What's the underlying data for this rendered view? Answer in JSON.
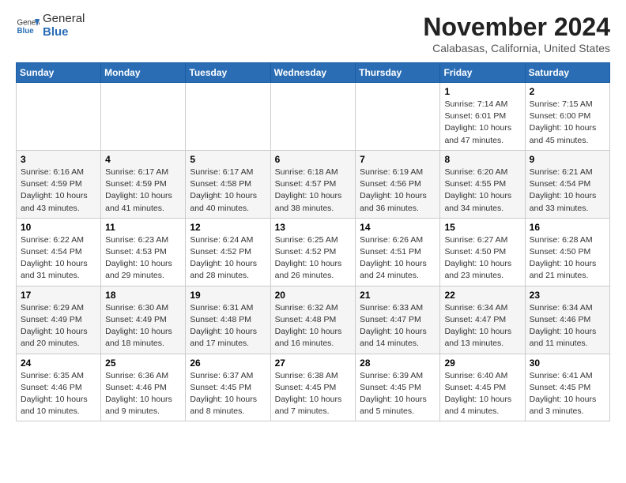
{
  "header": {
    "logo_general": "General",
    "logo_blue": "Blue",
    "month": "November 2024",
    "location": "Calabasas, California, United States"
  },
  "weekdays": [
    "Sunday",
    "Monday",
    "Tuesday",
    "Wednesday",
    "Thursday",
    "Friday",
    "Saturday"
  ],
  "weeks": [
    [
      {
        "day": "",
        "info": ""
      },
      {
        "day": "",
        "info": ""
      },
      {
        "day": "",
        "info": ""
      },
      {
        "day": "",
        "info": ""
      },
      {
        "day": "",
        "info": ""
      },
      {
        "day": "1",
        "info": "Sunrise: 7:14 AM\nSunset: 6:01 PM\nDaylight: 10 hours and 47 minutes."
      },
      {
        "day": "2",
        "info": "Sunrise: 7:15 AM\nSunset: 6:00 PM\nDaylight: 10 hours and 45 minutes."
      }
    ],
    [
      {
        "day": "3",
        "info": "Sunrise: 6:16 AM\nSunset: 4:59 PM\nDaylight: 10 hours and 43 minutes."
      },
      {
        "day": "4",
        "info": "Sunrise: 6:17 AM\nSunset: 4:59 PM\nDaylight: 10 hours and 41 minutes."
      },
      {
        "day": "5",
        "info": "Sunrise: 6:17 AM\nSunset: 4:58 PM\nDaylight: 10 hours and 40 minutes."
      },
      {
        "day": "6",
        "info": "Sunrise: 6:18 AM\nSunset: 4:57 PM\nDaylight: 10 hours and 38 minutes."
      },
      {
        "day": "7",
        "info": "Sunrise: 6:19 AM\nSunset: 4:56 PM\nDaylight: 10 hours and 36 minutes."
      },
      {
        "day": "8",
        "info": "Sunrise: 6:20 AM\nSunset: 4:55 PM\nDaylight: 10 hours and 34 minutes."
      },
      {
        "day": "9",
        "info": "Sunrise: 6:21 AM\nSunset: 4:54 PM\nDaylight: 10 hours and 33 minutes."
      }
    ],
    [
      {
        "day": "10",
        "info": "Sunrise: 6:22 AM\nSunset: 4:54 PM\nDaylight: 10 hours and 31 minutes."
      },
      {
        "day": "11",
        "info": "Sunrise: 6:23 AM\nSunset: 4:53 PM\nDaylight: 10 hours and 29 minutes."
      },
      {
        "day": "12",
        "info": "Sunrise: 6:24 AM\nSunset: 4:52 PM\nDaylight: 10 hours and 28 minutes."
      },
      {
        "day": "13",
        "info": "Sunrise: 6:25 AM\nSunset: 4:52 PM\nDaylight: 10 hours and 26 minutes."
      },
      {
        "day": "14",
        "info": "Sunrise: 6:26 AM\nSunset: 4:51 PM\nDaylight: 10 hours and 24 minutes."
      },
      {
        "day": "15",
        "info": "Sunrise: 6:27 AM\nSunset: 4:50 PM\nDaylight: 10 hours and 23 minutes."
      },
      {
        "day": "16",
        "info": "Sunrise: 6:28 AM\nSunset: 4:50 PM\nDaylight: 10 hours and 21 minutes."
      }
    ],
    [
      {
        "day": "17",
        "info": "Sunrise: 6:29 AM\nSunset: 4:49 PM\nDaylight: 10 hours and 20 minutes."
      },
      {
        "day": "18",
        "info": "Sunrise: 6:30 AM\nSunset: 4:49 PM\nDaylight: 10 hours and 18 minutes."
      },
      {
        "day": "19",
        "info": "Sunrise: 6:31 AM\nSunset: 4:48 PM\nDaylight: 10 hours and 17 minutes."
      },
      {
        "day": "20",
        "info": "Sunrise: 6:32 AM\nSunset: 4:48 PM\nDaylight: 10 hours and 16 minutes."
      },
      {
        "day": "21",
        "info": "Sunrise: 6:33 AM\nSunset: 4:47 PM\nDaylight: 10 hours and 14 minutes."
      },
      {
        "day": "22",
        "info": "Sunrise: 6:34 AM\nSunset: 4:47 PM\nDaylight: 10 hours and 13 minutes."
      },
      {
        "day": "23",
        "info": "Sunrise: 6:34 AM\nSunset: 4:46 PM\nDaylight: 10 hours and 11 minutes."
      }
    ],
    [
      {
        "day": "24",
        "info": "Sunrise: 6:35 AM\nSunset: 4:46 PM\nDaylight: 10 hours and 10 minutes."
      },
      {
        "day": "25",
        "info": "Sunrise: 6:36 AM\nSunset: 4:46 PM\nDaylight: 10 hours and 9 minutes."
      },
      {
        "day": "26",
        "info": "Sunrise: 6:37 AM\nSunset: 4:45 PM\nDaylight: 10 hours and 8 minutes."
      },
      {
        "day": "27",
        "info": "Sunrise: 6:38 AM\nSunset: 4:45 PM\nDaylight: 10 hours and 7 minutes."
      },
      {
        "day": "28",
        "info": "Sunrise: 6:39 AM\nSunset: 4:45 PM\nDaylight: 10 hours and 5 minutes."
      },
      {
        "day": "29",
        "info": "Sunrise: 6:40 AM\nSunset: 4:45 PM\nDaylight: 10 hours and 4 minutes."
      },
      {
        "day": "30",
        "info": "Sunrise: 6:41 AM\nSunset: 4:45 PM\nDaylight: 10 hours and 3 minutes."
      }
    ]
  ]
}
